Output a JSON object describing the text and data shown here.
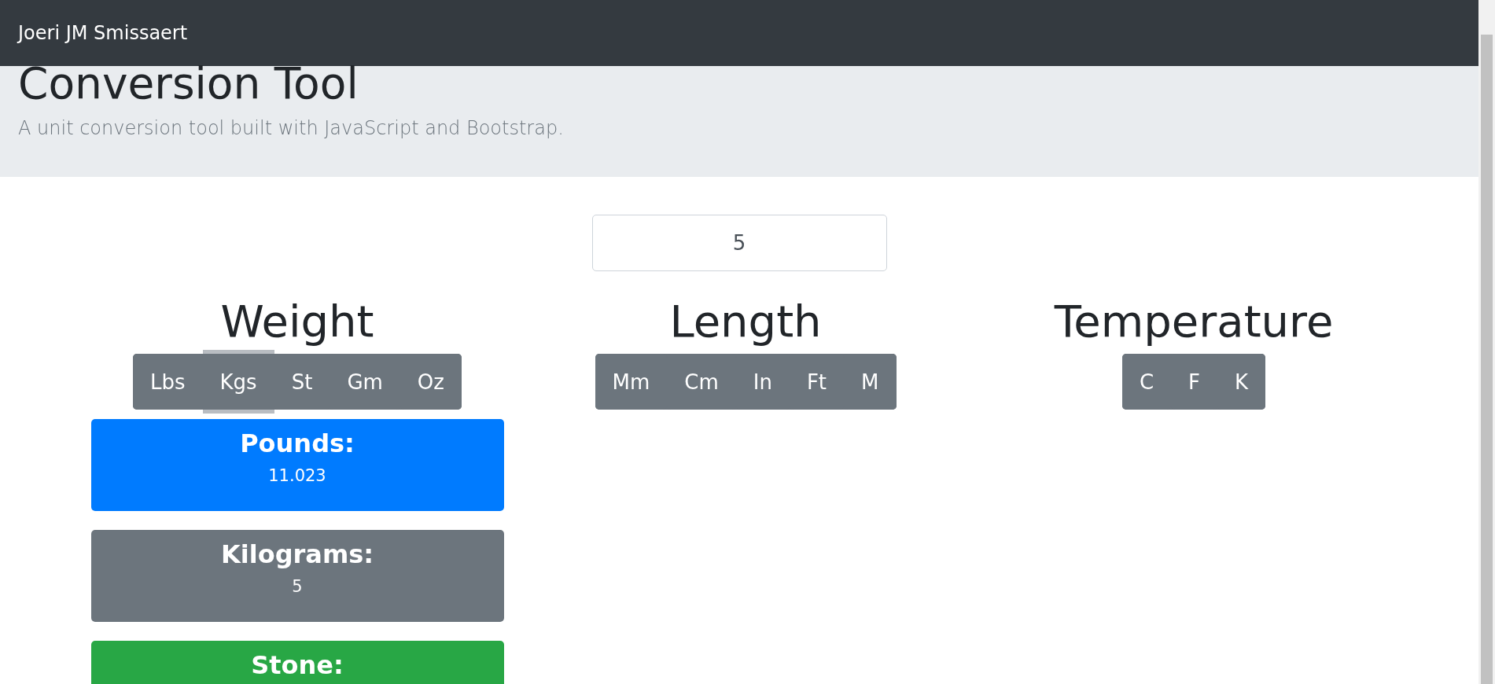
{
  "navbar": {
    "brand": "Joeri JM Smissaert"
  },
  "header": {
    "title": "Conversion Tool",
    "subtitle": "A unit conversion tool built with JavaScript and Bootstrap."
  },
  "input": {
    "value": "5"
  },
  "converters": [
    {
      "heading": "Weight",
      "units": [
        {
          "label": "Lbs",
          "selected": false
        },
        {
          "label": "Kgs",
          "selected": true
        },
        {
          "label": "St",
          "selected": false
        },
        {
          "label": "Gm",
          "selected": false
        },
        {
          "label": "Oz",
          "selected": false
        }
      ],
      "results": [
        {
          "label": "Pounds:",
          "value": "11.023",
          "color": "#007bff"
        },
        {
          "label": "Kilograms:",
          "value": "5",
          "color": "#6c757d"
        },
        {
          "label": "Stone:",
          "color": "#28a745"
        }
      ]
    },
    {
      "heading": "Length",
      "units": [
        {
          "label": "Mm",
          "selected": false
        },
        {
          "label": "Cm",
          "selected": false
        },
        {
          "label": "In",
          "selected": false
        },
        {
          "label": "Ft",
          "selected": false
        },
        {
          "label": "M",
          "selected": false
        }
      ]
    },
    {
      "heading": "Temperature",
      "units": [
        {
          "label": "C",
          "selected": false
        },
        {
          "label": "F",
          "selected": false
        },
        {
          "label": "K",
          "selected": false
        }
      ]
    }
  ]
}
